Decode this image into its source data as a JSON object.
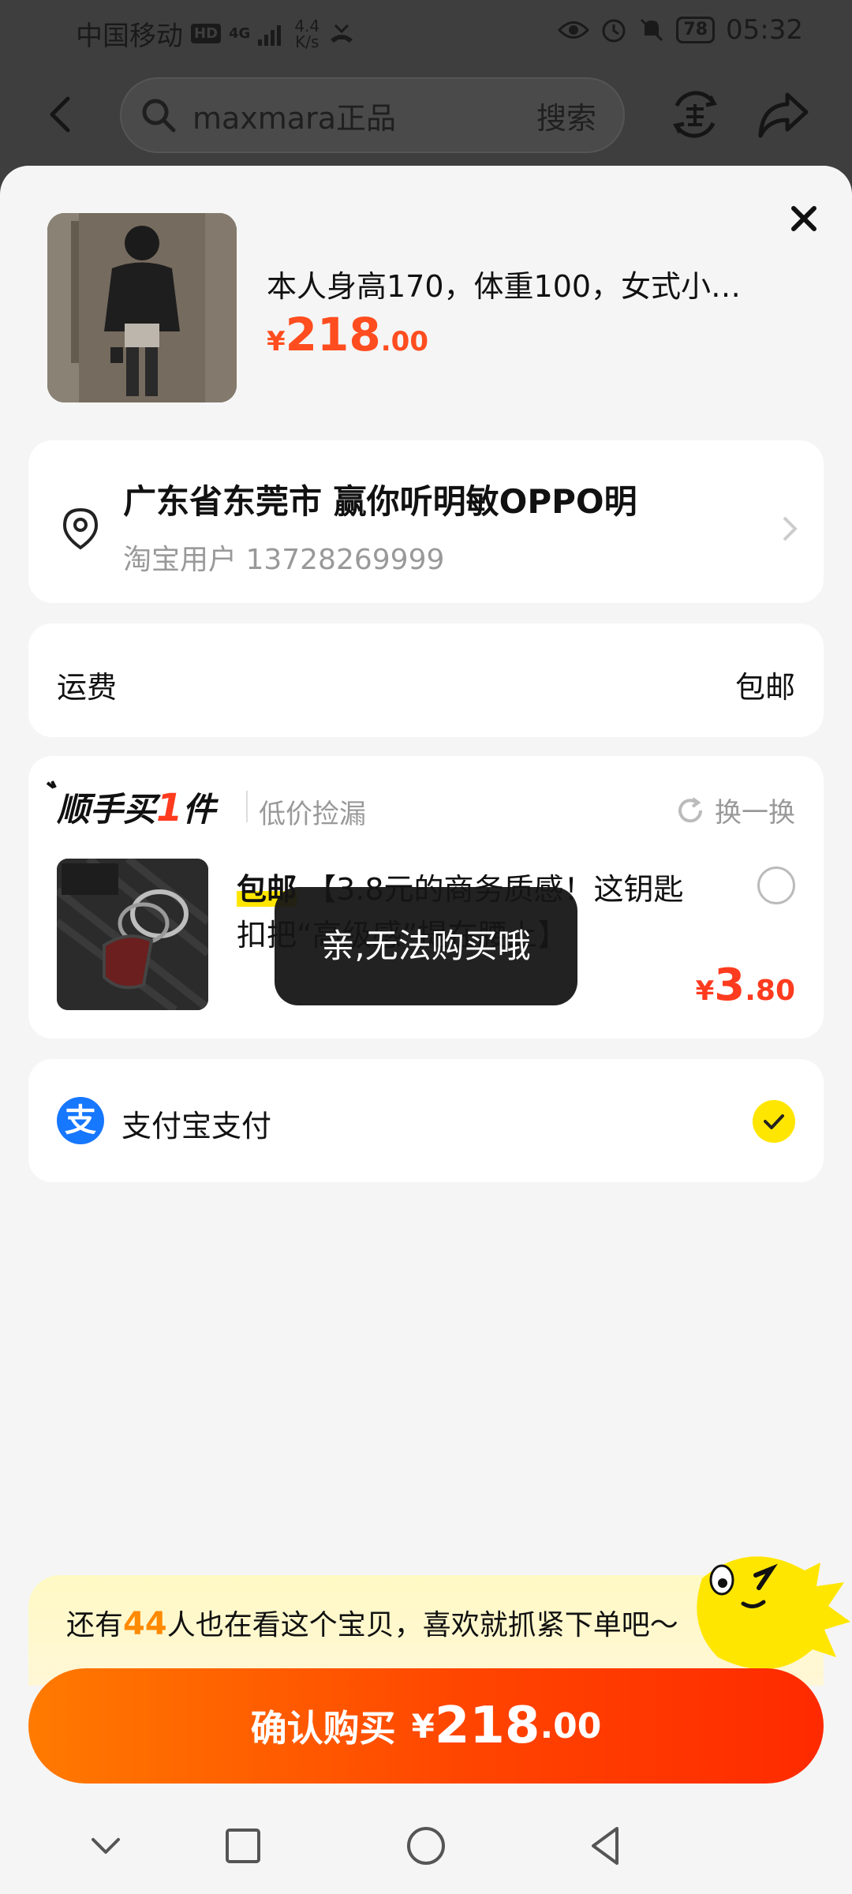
{
  "status_bar": {
    "carrier": "中国移动",
    "hd": "HD",
    "signal": "4G",
    "net_speed_value": "4.4",
    "net_speed_unit": "K/s",
    "battery": "78",
    "time": "05:32"
  },
  "header": {
    "search_query": "maxmara正品",
    "search_button": "搜索"
  },
  "product": {
    "title": "本人身高170，体重100，女式小…",
    "price_currency": "¥",
    "price_int": "218",
    "price_dec": ".00"
  },
  "address": {
    "line1": "广东省东莞市 赢你听明敏OPPO明",
    "line2": "淘宝用户 13728269999"
  },
  "shipping": {
    "label": "运费",
    "value": "包邮"
  },
  "addon": {
    "title_prefix": "顺手买",
    "title_num": "1",
    "title_suffix": "件",
    "subtitle": "低价捡漏",
    "swap": "换一换",
    "item_free": "包邮",
    "item_title": " 【3.8元的商务质感！这钥匙扣把“高级感”提在腰上】",
    "price_currency": "¥",
    "price_int": "3",
    "price_dec": ".80"
  },
  "payment": {
    "logo": "支",
    "label": "支付宝支付"
  },
  "toast": "亲,无法购买哦",
  "banner": {
    "prefix": "还有",
    "count": "44",
    "suffix": "人也在看这个宝贝，喜欢就抓紧下单吧～"
  },
  "buy_button": {
    "label": "确认购买",
    "currency": "¥",
    "int": "218",
    "dec": ".00"
  },
  "colors": {
    "accent": "#ff4d1f",
    "yellow": "#ffe600",
    "alipay": "#1677ff"
  }
}
